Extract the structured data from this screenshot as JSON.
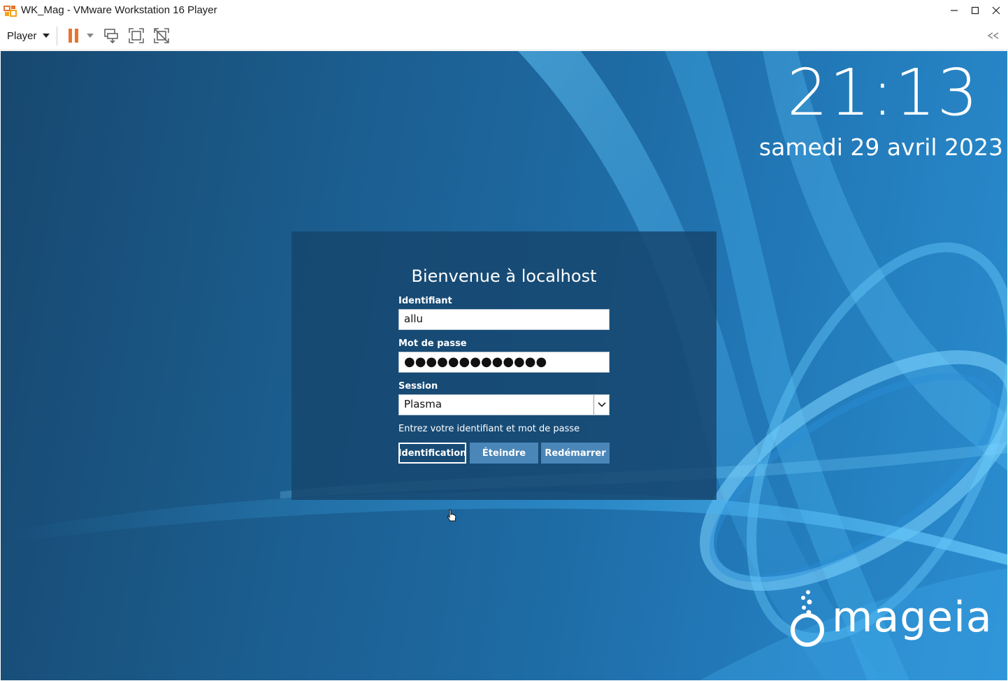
{
  "window": {
    "title": "WK_Mag - VMware Workstation 16 Player"
  },
  "toolbar": {
    "player_label": "Player",
    "accent_color": "#e8742c",
    "icons": [
      "pause-icon",
      "send-ctrl-alt-del-icon",
      "fullscreen-icon",
      "unity-icon",
      "collapse-icon"
    ]
  },
  "guest": {
    "clock": "21:13",
    "date": "samedi 29 avril 2023",
    "login": {
      "welcome": "Bienvenue à localhost",
      "username_label": "Identifiant",
      "username_value": "allu",
      "password_label": "Mot de passe",
      "password_value": "●●●●●●●●●●●●●",
      "session_label": "Session",
      "session_value": "Plasma",
      "hint": "Entrez votre identifiant et mot de passe",
      "login_button": "Identification",
      "shutdown_button": "Éteindre",
      "reboot_button": "Redémarrer"
    },
    "logo_text": "mageia"
  }
}
